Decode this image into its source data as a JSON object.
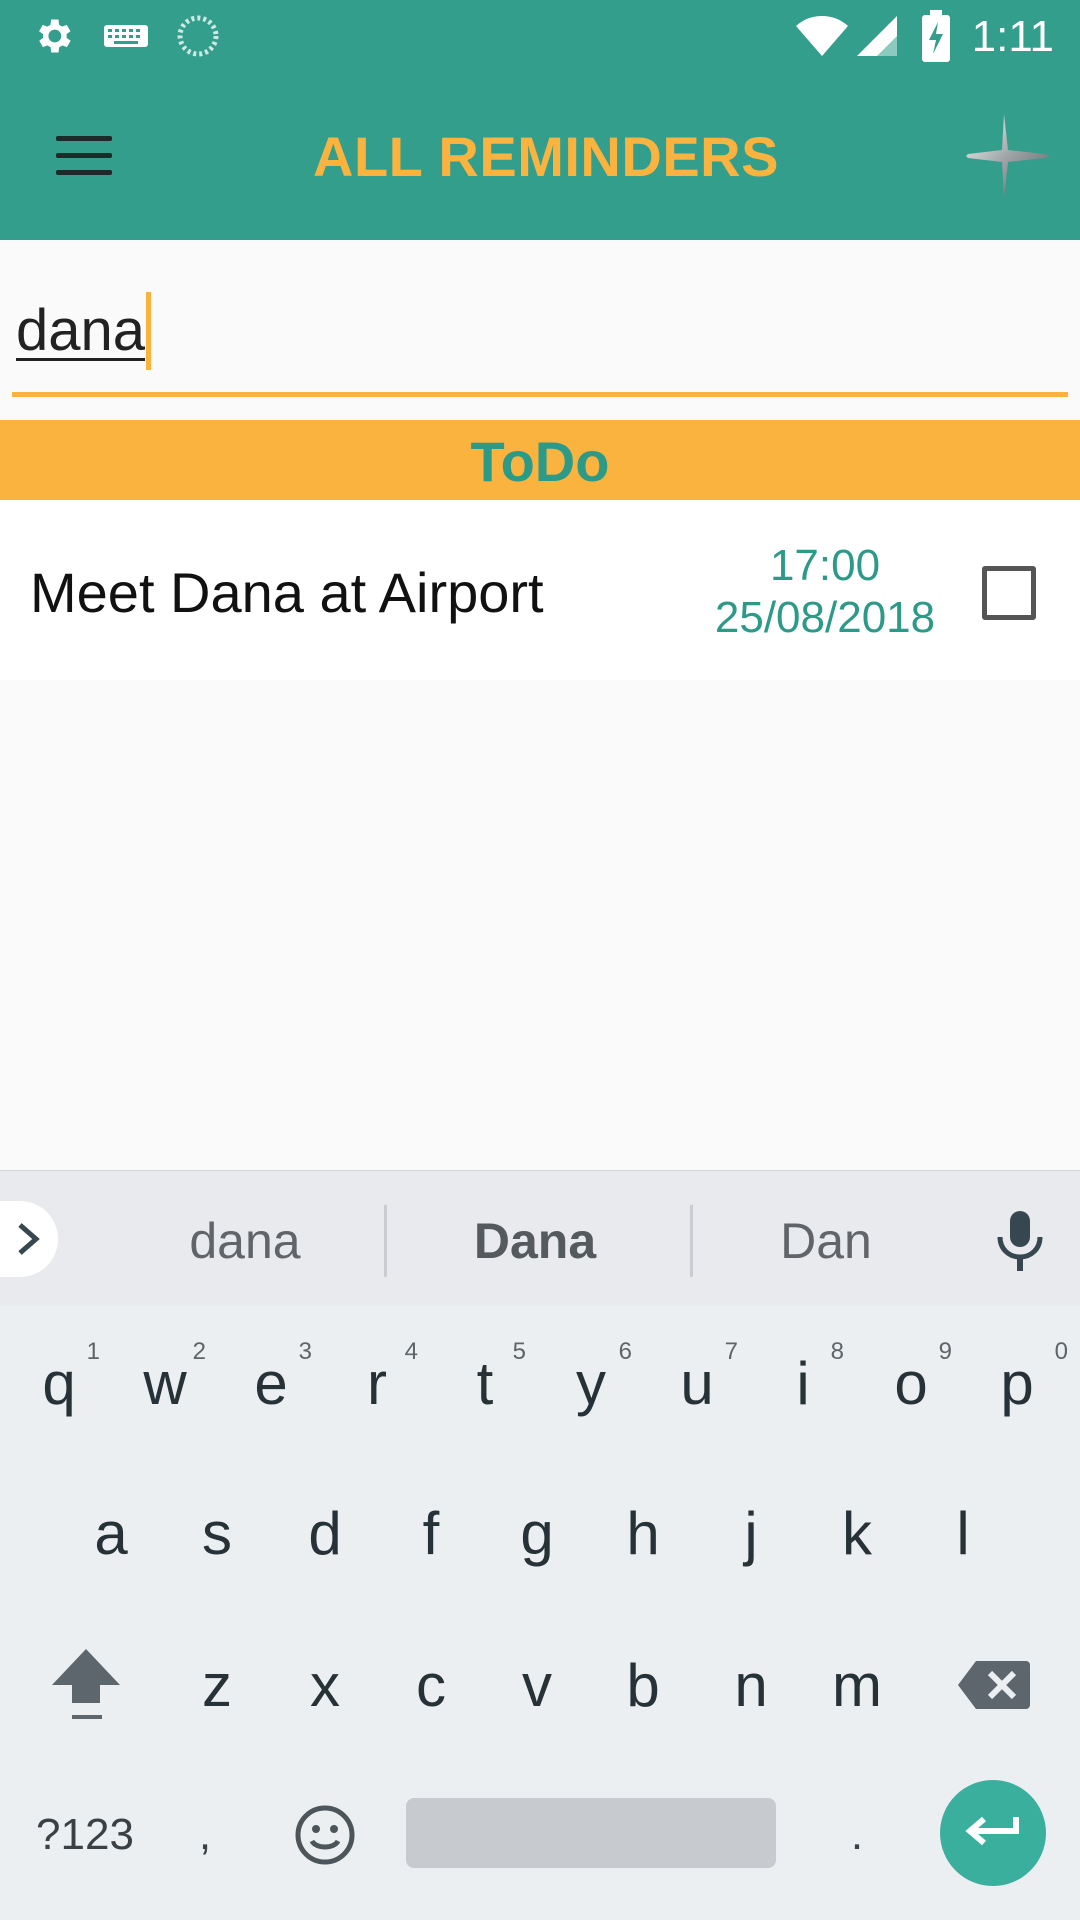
{
  "status_bar": {
    "time": "1:11",
    "icons": [
      "settings-icon",
      "keyboard-icon",
      "sync-icon",
      "wifi-icon",
      "cell-signal-icon",
      "battery-charging-icon"
    ]
  },
  "app_bar": {
    "title": "ALL REMINDERS",
    "menu_icon": "hamburger-menu-icon",
    "add_icon": "plus-icon"
  },
  "search": {
    "value": "dana"
  },
  "section": {
    "title": "ToDo"
  },
  "reminders": [
    {
      "title": "Meet Dana at Airport",
      "time": "17:00",
      "date": "25/08/2018",
      "checked": false
    }
  ],
  "keyboard": {
    "suggestions": [
      "dana",
      "Dana",
      "Dan"
    ],
    "row1": [
      {
        "key": "q",
        "hint": "1"
      },
      {
        "key": "w",
        "hint": "2"
      },
      {
        "key": "e",
        "hint": "3"
      },
      {
        "key": "r",
        "hint": "4"
      },
      {
        "key": "t",
        "hint": "5"
      },
      {
        "key": "y",
        "hint": "6"
      },
      {
        "key": "u",
        "hint": "7"
      },
      {
        "key": "i",
        "hint": "8"
      },
      {
        "key": "o",
        "hint": "9"
      },
      {
        "key": "p",
        "hint": "0"
      }
    ],
    "row2": [
      "a",
      "s",
      "d",
      "f",
      "g",
      "h",
      "j",
      "k",
      "l"
    ],
    "row3": [
      "z",
      "x",
      "c",
      "v",
      "b",
      "n",
      "m"
    ],
    "symbols_label": "?123",
    "comma": ",",
    "period": "."
  },
  "colors": {
    "primary": "#339e8c",
    "accent": "#fbb33f",
    "teal_text": "#2d9a88"
  }
}
